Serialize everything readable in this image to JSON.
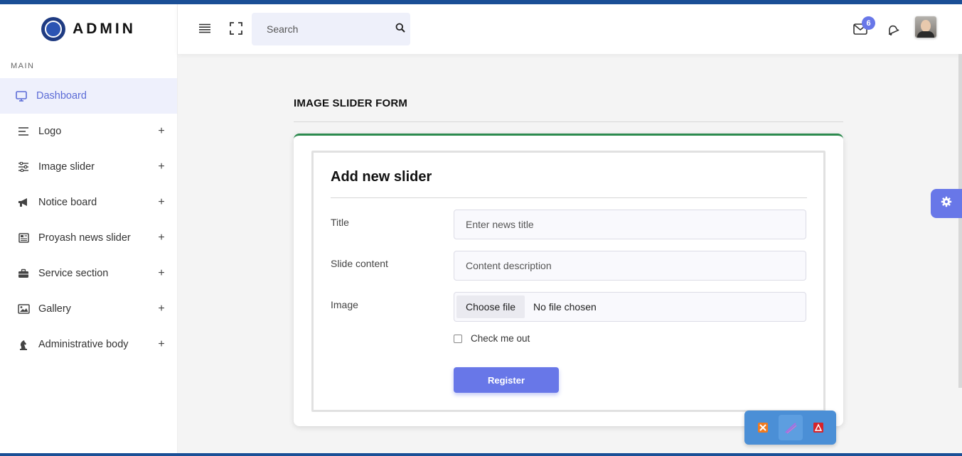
{
  "brand": {
    "name": "ADMIN"
  },
  "sidebar": {
    "section_label": "MAIN",
    "items": [
      {
        "label": "Dashboard",
        "icon": "monitor-icon",
        "active": true,
        "expandable": false
      },
      {
        "label": "Logo",
        "icon": "menu-lines-icon",
        "expand": "+"
      },
      {
        "label": "Image slider",
        "icon": "sliders-icon",
        "expand": "+"
      },
      {
        "label": "Notice board",
        "icon": "megaphone-icon",
        "expand": "+"
      },
      {
        "label": "Proyash news slider",
        "icon": "newspaper-icon",
        "expand": "+"
      },
      {
        "label": "Service section",
        "icon": "briefcase-icon",
        "expand": "+"
      },
      {
        "label": "Gallery",
        "icon": "image-icon",
        "expand": "+"
      },
      {
        "label": "Administrative body",
        "icon": "chess-knight-icon",
        "expand": "+"
      }
    ]
  },
  "header": {
    "search": {
      "placeholder": "Search"
    },
    "mail_badge": "6"
  },
  "page": {
    "title": "IMAGE SLIDER FORM"
  },
  "form": {
    "heading": "Add new slider",
    "title_label": "Title",
    "title_placeholder": "Enter news title",
    "content_label": "Slide content",
    "content_placeholder": "Content description",
    "image_label": "Image",
    "file_button": "Choose file",
    "file_status": "No file chosen",
    "checkbox_label": "Check me out",
    "submit": "Register"
  },
  "colors": {
    "accent": "#6877e8",
    "card_top": "#2c8a4e",
    "topbar": "#1a4f96",
    "active_bg": "#eef0fc"
  }
}
